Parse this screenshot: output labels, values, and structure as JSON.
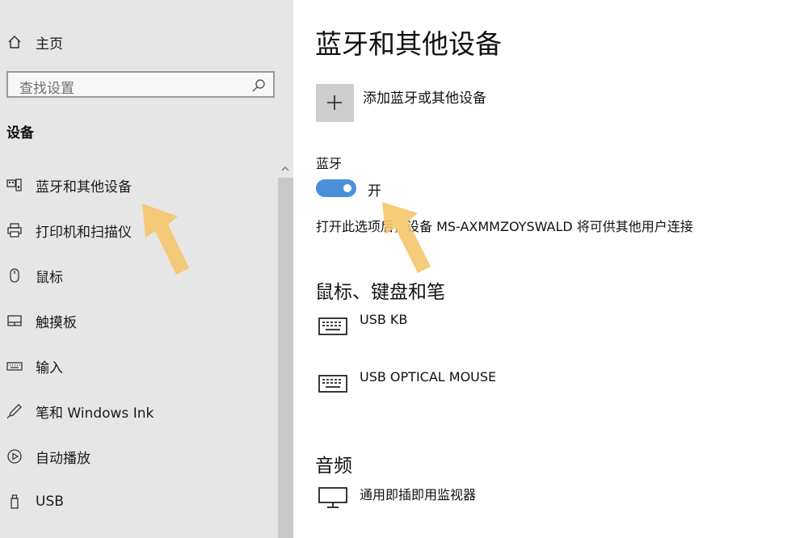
{
  "sidebar": {
    "home_label": "主页",
    "search_placeholder": "查找设置",
    "section_title": "设备",
    "items": [
      {
        "label": "蓝牙和其他设备",
        "icon": "bluetooth-devices-icon"
      },
      {
        "label": "打印机和扫描仪",
        "icon": "printer-icon"
      },
      {
        "label": "鼠标",
        "icon": "mouse-icon"
      },
      {
        "label": "触摸板",
        "icon": "touchpad-icon"
      },
      {
        "label": "输入",
        "icon": "keyboard-icon"
      },
      {
        "label": "笔和 Windows Ink",
        "icon": "pen-icon"
      },
      {
        "label": "自动播放",
        "icon": "autoplay-icon"
      },
      {
        "label": "USB",
        "icon": "usb-icon"
      }
    ]
  },
  "main": {
    "title": "蓝牙和其他设备",
    "add_device_label": "添加蓝牙或其他设备",
    "bluetooth": {
      "label": "蓝牙",
      "state_label": "开",
      "is_on": true,
      "description": "打开此选项后，设备 MS-AXMMZOYSWALD 将可供其他用户连接"
    },
    "input_section": {
      "title": "鼠标、键盘和笔",
      "devices": [
        {
          "name": "USB KB",
          "icon": "keyboard-icon"
        },
        {
          "name": "USB OPTICAL MOUSE",
          "icon": "keyboard-icon"
        }
      ]
    },
    "audio_section": {
      "title": "音频",
      "devices": [
        {
          "name": "通用即插即用监视器",
          "icon": "monitor-icon"
        }
      ]
    }
  },
  "colors": {
    "sidebar_bg": "#e6e6e6",
    "toggle_on": "#4a90d9",
    "annotation_arrow": "#f5c56a"
  }
}
